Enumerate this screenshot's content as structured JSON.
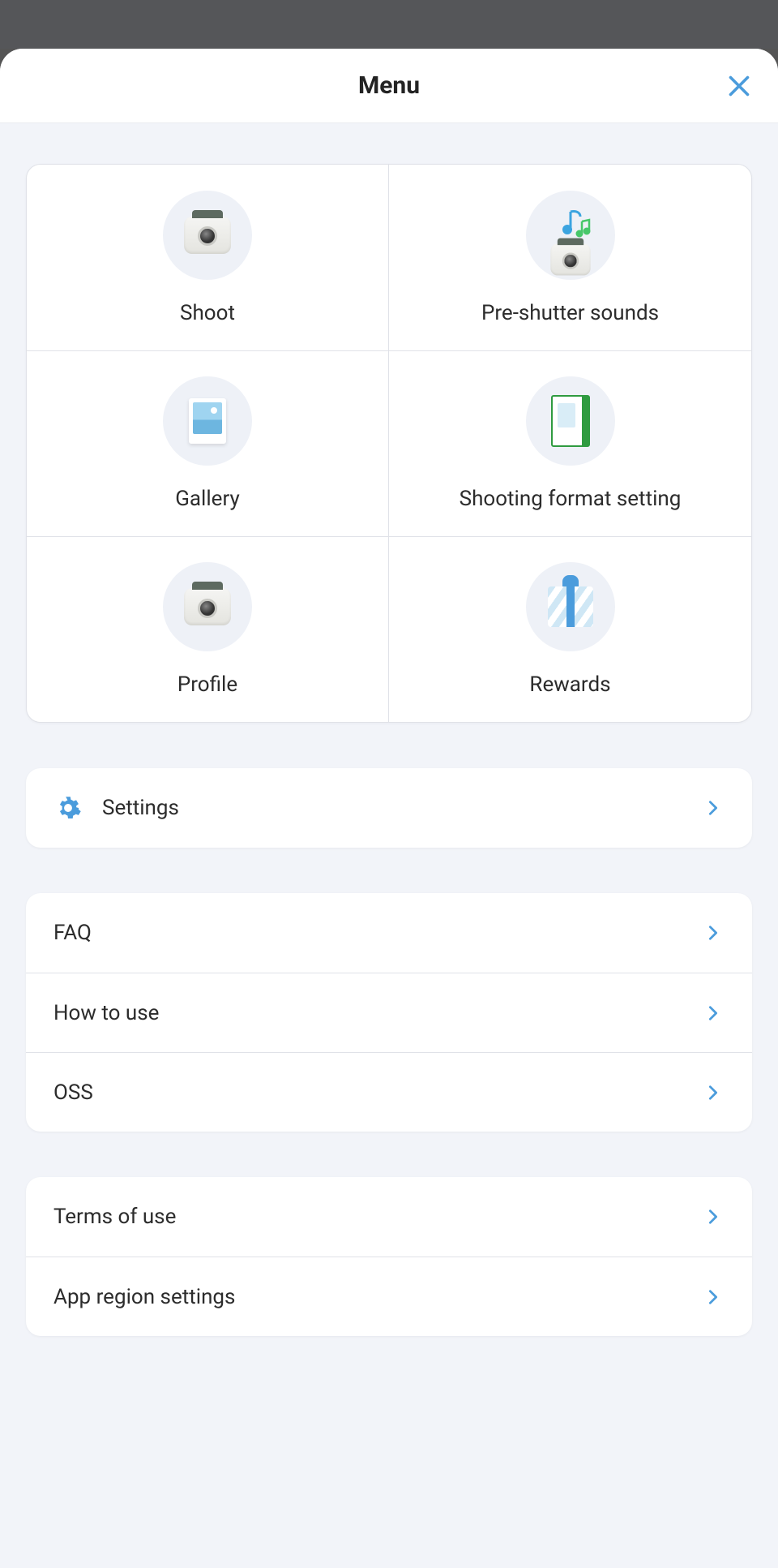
{
  "title": "Menu",
  "grid": [
    {
      "label": "Shoot",
      "icon": "camera"
    },
    {
      "label": "Pre-shutter sounds",
      "icon": "music"
    },
    {
      "label": "Gallery",
      "icon": "photo"
    },
    {
      "label": "Shooting format setting",
      "icon": "film"
    },
    {
      "label": "Profile",
      "icon": "camera"
    },
    {
      "label": "Rewards",
      "icon": "gift"
    }
  ],
  "settings": {
    "label": "Settings"
  },
  "help": [
    {
      "label": "FAQ"
    },
    {
      "label": "How to use"
    },
    {
      "label": "OSS"
    }
  ],
  "info": [
    {
      "label": "Terms of use"
    },
    {
      "label": "App region settings"
    }
  ],
  "colors": {
    "accent": "#4b9cdc"
  }
}
